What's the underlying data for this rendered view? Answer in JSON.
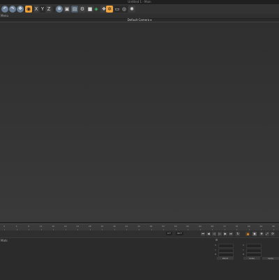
{
  "window": {
    "title": "Untitled 1 - Main"
  },
  "toolbar": {
    "buttons": [
      {
        "name": "undo-button",
        "glyph": "↶"
      },
      {
        "name": "redo-button",
        "glyph": "↷"
      },
      {
        "name": "move-tool-button",
        "glyph": "✥"
      },
      {
        "name": "scale-tool-button",
        "glyph": "⤢"
      },
      {
        "name": "rotate-tool-button",
        "glyph": "⟳"
      },
      {
        "name": "live-selection-button",
        "glyph": "◉"
      },
      {
        "name": "lock-x-button",
        "glyph": "X"
      },
      {
        "name": "lock-y-button",
        "glyph": "Y"
      },
      {
        "name": "lock-z-button",
        "glyph": "Z"
      },
      {
        "name": "world-coords-button",
        "glyph": "⊕"
      },
      {
        "name": "render-view-button",
        "glyph": "▣"
      },
      {
        "name": "render-picture-viewer-button",
        "glyph": "▤"
      },
      {
        "name": "render-settings-button",
        "glyph": "⚙"
      },
      {
        "name": "cube-button",
        "glyph": "■"
      },
      {
        "name": "pen-button",
        "glyph": "✎"
      },
      {
        "name": "subdivision-button",
        "glyph": "◈"
      },
      {
        "name": "array-button",
        "glyph": "❖"
      },
      {
        "name": "effector-button",
        "glyph": "✲"
      },
      {
        "name": "floor-button",
        "glyph": "▭"
      },
      {
        "name": "camera-button",
        "glyph": "◎"
      },
      {
        "name": "light-button",
        "glyph": "✺"
      }
    ]
  },
  "menu": {
    "label": "Menu"
  },
  "viewport": {
    "camera_label": "Default Camera ▾"
  },
  "timeline": {
    "ticks": [
      "0",
      "4",
      "8",
      "12",
      "16",
      "20",
      "24",
      "28",
      "32",
      "36",
      "40",
      "44",
      "48",
      "52",
      "56",
      "60",
      "64",
      "68",
      "72",
      "76",
      "80",
      "84",
      "88"
    ],
    "current_frame": "0 F",
    "start_frame": "90 F",
    "end_frame": "90 F"
  },
  "materials": {
    "label": "Mats"
  },
  "coordinates": {
    "rows": [
      {
        "a": "X",
        "av": "0 cm",
        "b": "X",
        "bv": "0 cm",
        "c": "H",
        "cv": "0 °"
      },
      {
        "a": "Y",
        "av": "0 cm",
        "b": "Y",
        "bv": "0 cm",
        "c": "P",
        "cv": "0 °"
      },
      {
        "a": "Z",
        "av": "0 cm",
        "b": "Z",
        "bv": "0 cm",
        "c": "B",
        "cv": "0 °"
      }
    ],
    "mode_label": "World",
    "size_label": "Scale",
    "apply_label": "Apply"
  }
}
